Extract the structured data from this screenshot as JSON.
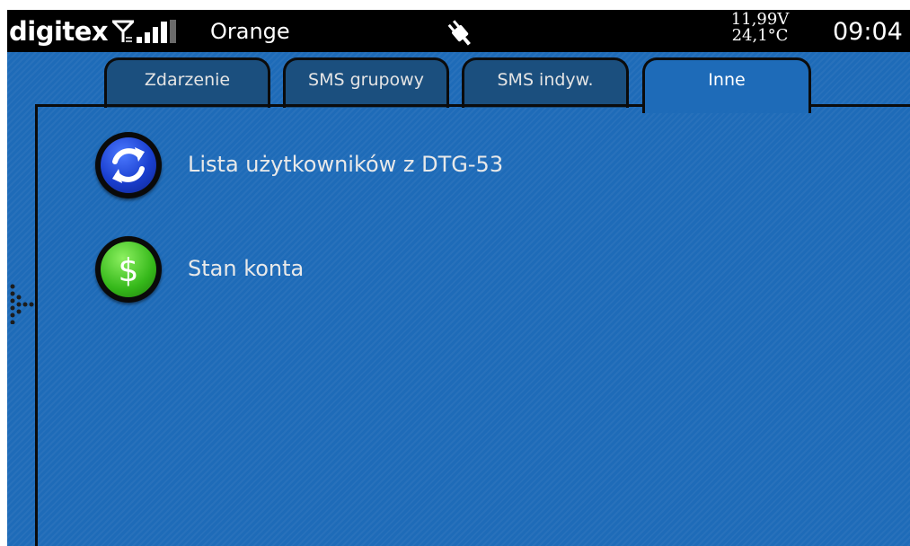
{
  "statusbar": {
    "brand": "digitex",
    "carrier": "Orange",
    "voltage": "11,99V",
    "temperature": "24,1°C",
    "time": "09:04",
    "signal_icon": "signal-strength-icon",
    "antenna_icon": "antenna-icon",
    "power_icon": "power-plug-icon"
  },
  "tabs": [
    {
      "label": "Zdarzenie",
      "active": false
    },
    {
      "label": "SMS grupowy",
      "active": false
    },
    {
      "label": "SMS indyw.",
      "active": false
    },
    {
      "label": "Inne",
      "active": true
    }
  ],
  "menu": [
    {
      "label": "Lista użytkowników z DTG-53",
      "icon": "refresh-icon",
      "color": "#1a3fcf"
    },
    {
      "label": "Stan konta",
      "icon": "dollar-icon",
      "color": "#35b81a"
    }
  ],
  "colors": {
    "background": "#1e6bb8",
    "tab_inactive": "#1b4f7e",
    "statusbar": "#000000"
  }
}
